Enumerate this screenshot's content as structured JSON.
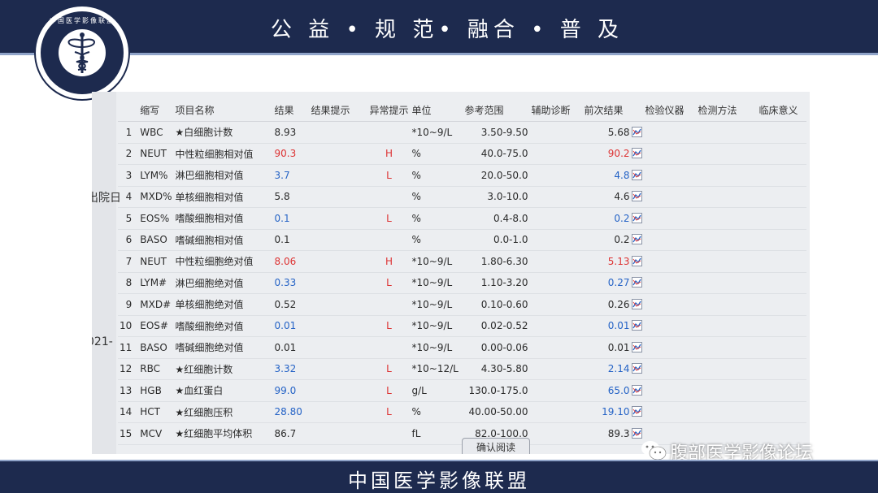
{
  "header": {
    "slogan": "公 益 • 规 范• 融合 • 普 及"
  },
  "footer": {
    "title": "中国医学影像联盟"
  },
  "logo": {
    "ring_text": "中国医学影像联盟"
  },
  "watermark": {
    "text": "腹部医学影像论坛",
    "icon": "wechat-icon"
  },
  "photo": {
    "edge_fragments": [
      "出院日",
      "021-"
    ]
  },
  "table": {
    "columns": [
      "",
      "缩写",
      "项目名称",
      "结果",
      "结果提示",
      "异常提示",
      "单位",
      "参考范围",
      "辅助诊断",
      "前次结果",
      "检验仪器",
      "检测方法",
      "临床意义"
    ],
    "rows": [
      {
        "idx": "1",
        "abbr": "WBC",
        "name": "★白细胞计数",
        "result": "8.93",
        "flag": "",
        "unit": "*10~9/L",
        "range": "3.50-9.50",
        "prev": "5.68",
        "tone": ""
      },
      {
        "idx": "2",
        "abbr": "NEUT",
        "name": "中性粒细胞相对值",
        "result": "90.3",
        "flag": "H",
        "unit": "%",
        "range": "40.0-75.0",
        "prev": "90.2",
        "tone": "red"
      },
      {
        "idx": "3",
        "abbr": "LYM%",
        "name": "淋巴细胞相对值",
        "result": "3.7",
        "flag": "L",
        "unit": "%",
        "range": "20.0-50.0",
        "prev": "4.8",
        "tone": "blue"
      },
      {
        "idx": "4",
        "abbr": "MXD%",
        "name": "单核细胞相对值",
        "result": "5.8",
        "flag": "",
        "unit": "%",
        "range": "3.0-10.0",
        "prev": "4.6",
        "tone": ""
      },
      {
        "idx": "5",
        "abbr": "EOS%",
        "name": "嗜酸细胞相对值",
        "result": "0.1",
        "flag": "L",
        "unit": "%",
        "range": "0.4-8.0",
        "prev": "0.2",
        "tone": "blue"
      },
      {
        "idx": "6",
        "abbr": "BASO",
        "name": "嗜碱细胞相对值",
        "result": "0.1",
        "flag": "",
        "unit": "%",
        "range": "0.0-1.0",
        "prev": "0.2",
        "tone": ""
      },
      {
        "idx": "7",
        "abbr": "NEUT",
        "name": "中性粒细胞绝对值",
        "result": "8.06",
        "flag": "H",
        "unit": "*10~9/L",
        "range": "1.80-6.30",
        "prev": "5.13",
        "tone": "red"
      },
      {
        "idx": "8",
        "abbr": "LYM#",
        "name": "淋巴细胞绝对值",
        "result": "0.33",
        "flag": "L",
        "unit": "*10~9/L",
        "range": "1.10-3.20",
        "prev": "0.27",
        "tone": "blue"
      },
      {
        "idx": "9",
        "abbr": "MXD#",
        "name": "单核细胞绝对值",
        "result": "0.52",
        "flag": "",
        "unit": "*10~9/L",
        "range": "0.10-0.60",
        "prev": "0.26",
        "tone": ""
      },
      {
        "idx": "10",
        "abbr": "EOS#",
        "name": "嗜酸细胞绝对值",
        "result": "0.01",
        "flag": "L",
        "unit": "*10~9/L",
        "range": "0.02-0.52",
        "prev": "0.01",
        "tone": "blue"
      },
      {
        "idx": "11",
        "abbr": "BASO",
        "name": "嗜碱细胞绝对值",
        "result": "0.01",
        "flag": "",
        "unit": "*10~9/L",
        "range": "0.00-0.06",
        "prev": "0.01",
        "tone": ""
      },
      {
        "idx": "12",
        "abbr": "RBC",
        "name": "★红细胞计数",
        "result": "3.32",
        "flag": "L",
        "unit": "*10~12/L",
        "range": "4.30-5.80",
        "prev": "2.14",
        "tone": "blue"
      },
      {
        "idx": "13",
        "abbr": "HGB",
        "name": "★血红蛋白",
        "result": "99.0",
        "flag": "L",
        "unit": "g/L",
        "range": "130.0-175.0",
        "prev": "65.0",
        "tone": "blue"
      },
      {
        "idx": "14",
        "abbr": "HCT",
        "name": "★红细胞压积",
        "result": "28.80",
        "flag": "L",
        "unit": "%",
        "range": "40.00-50.00",
        "prev": "19.10",
        "tone": "blue"
      },
      {
        "idx": "15",
        "abbr": "MCV",
        "name": "★红细胞平均体积",
        "result": "86.7",
        "flag": "",
        "unit": "fL",
        "range": "82.0-100.0",
        "prev": "89.3",
        "tone": ""
      }
    ],
    "confirm_label": "确认阅读"
  },
  "colors": {
    "navy": "#1d2a4e",
    "high": "#d33333",
    "low": "#2563c6"
  }
}
